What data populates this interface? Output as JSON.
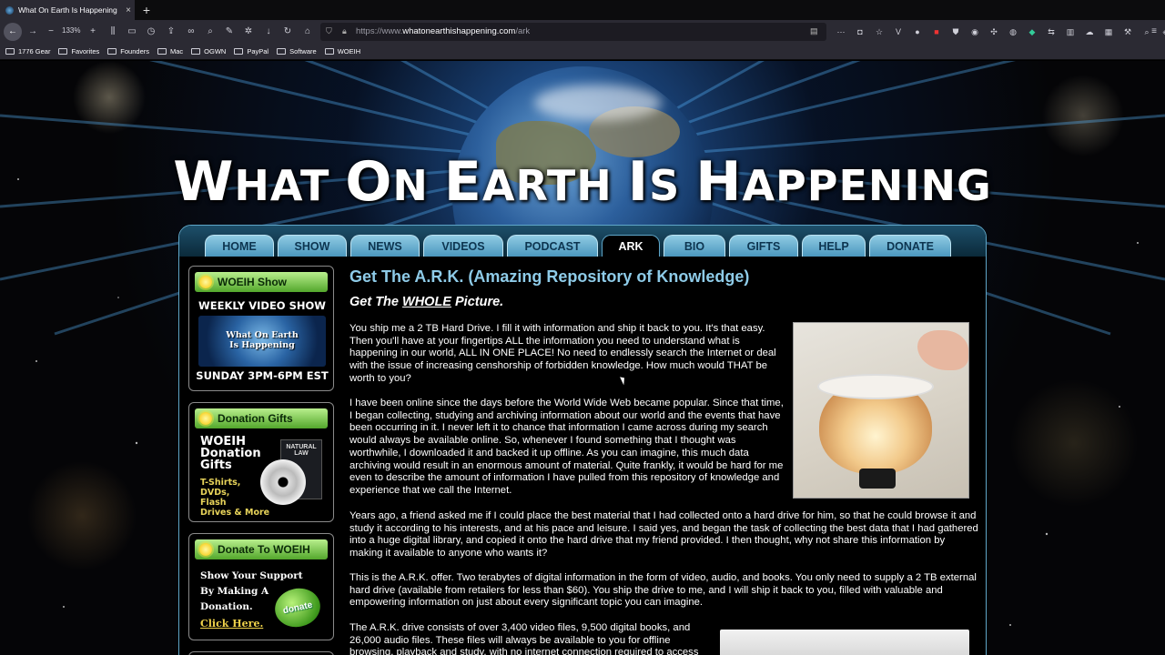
{
  "browser": {
    "tab_title": "What On Earth Is Happening -",
    "tab_close": "×",
    "new_tab": "+",
    "zoom": "133%",
    "url_prefix": "https://www.",
    "url_host": "whatonearthishappening.com",
    "url_path": "/ark",
    "bookmarks": [
      "1776 Gear",
      "Favorites",
      "Founders",
      "Mac",
      "OGWN",
      "PayPal",
      "Software",
      "WOEIH"
    ]
  },
  "site": {
    "title_W": "W",
    "title_hat": "HAT ",
    "title_O": "O",
    "title_n": "N ",
    "title_E": "E",
    "title_arth": "ARTH ",
    "title_I": "I",
    "title_s": "S ",
    "title_H": "H",
    "title_appening": "APPENING"
  },
  "nav": [
    "HOME",
    "SHOW",
    "NEWS",
    "VIDEOS",
    "PODCAST",
    "ARK",
    "BIO",
    "GIFTS",
    "HELP",
    "DONATE"
  ],
  "sidebar": {
    "show_head": "WOEIH Show",
    "show_line1": "WEEKLY VIDEO SHOW",
    "show_img_l1": "What On Earth",
    "show_img_l2": "Is Happening",
    "show_line2": "SUNDAY 3PM-6PM EST",
    "gifts_head": "Donation Gifts",
    "gifts_l1": "WOEIH",
    "gifts_l2": "Donation",
    "gifts_l3": "Gifts",
    "gifts_sub1": "T-Shirts,",
    "gifts_sub2": "DVDs,",
    "gifts_sub3": "Flash",
    "gifts_sub4": "Drives & More",
    "dvd_case": "NATURAL LAW",
    "donate_head": "Donate To WOEIH",
    "support_l1": "Show Your Support",
    "support_l2": "By Making A",
    "support_l3": "Donation.",
    "click_here": "Click Here.",
    "donate_btn": "donate"
  },
  "main": {
    "heading": "Get The A.R.K. (Amazing Repository of Knowledge)",
    "sub_pre": "Get The ",
    "sub_u": "WHOLE",
    "sub_post": " Picture.",
    "p1": "You ship me a 2 TB Hard Drive. I fill it with information and ship it back to you. It's that easy. Then you'll have at your fingertips ALL the information you need to understand what is happening in our world, ALL IN ONE PLACE! No need to endlessly search the Internet or deal with the issue of increasing censhorship of forbidden knowledge. How much would THAT be worth to you?",
    "p2": "I have been online since the days before the World Wide Web became popular. Since that time, I began collecting, studying and archiving information about our world and the events that have been occurring in it. I never left it to chance that information I came across during my search would always be available online. So, whenever I found something that I thought was worthwhile, I downloaded it and backed it up offline. As you can imagine, this much data archiving would result in an enormous amount of material. Quite frankly, it would be hard for me even to describe the amount of information I have pulled from this repository of knowledge and experience that we call the Internet.",
    "p3": "Years ago, a friend asked me if I could place the best material that I had collected onto a hard drive for him, so that he could browse it and study it according to his interests, and at his pace and leisure. I said yes, and began the task of collecting the best data that I had gathered into a huge digital library, and copied it onto the hard drive that my friend provided. I then thought, why not share this information by making it available to anyone who wants it?",
    "p4": "This is the A.R.K. offer. Two terabytes of digital information in the form of video, audio, and books. You only need to supply a 2 TB external hard drive (available from retailers for less than $60). You ship the drive to me, and I will ship it back to you, filled with valuable and empowering information on just about every significant topic you can imagine.",
    "p5": "The A.R.K. drive consists of over 3,400 video files, 9,500 digital books, and 26,000 audio files. These files will always be available to you for offline browsing, playback and study, with no internet connection required to access"
  }
}
